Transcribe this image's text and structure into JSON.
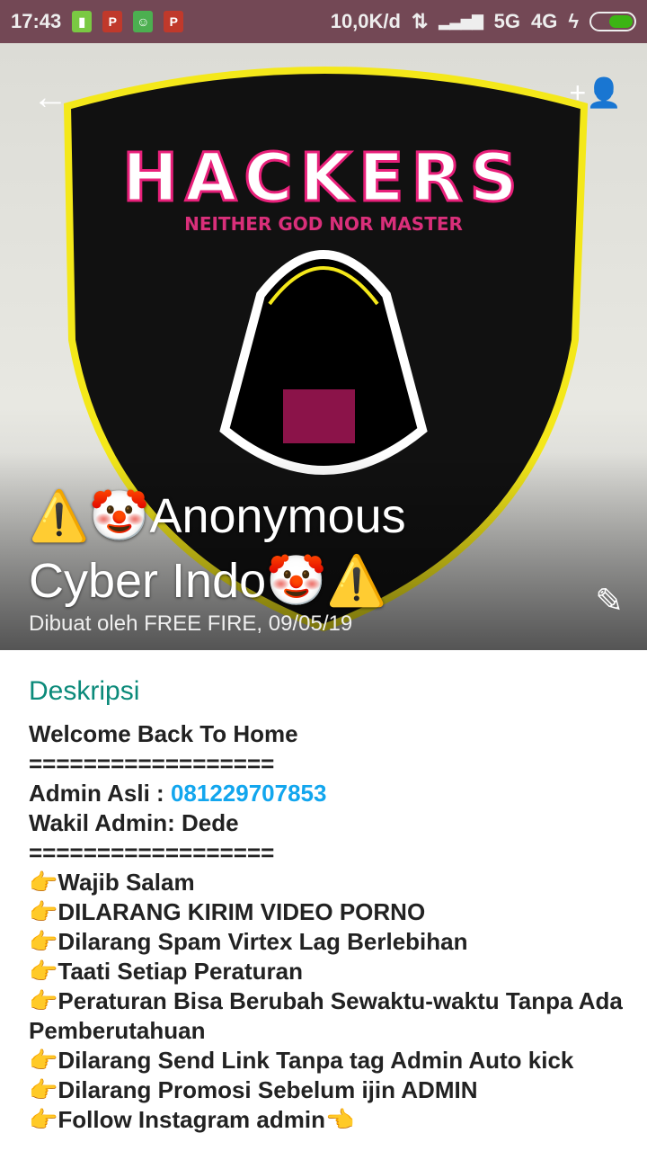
{
  "status_bar": {
    "time": "17:43",
    "speed": "10,0K/d",
    "network1": "5G",
    "network2": "4G",
    "battery_color": "#3cb414"
  },
  "header": {
    "back_icon": "arrow-left-icon",
    "add_participant_icon": "person-add-icon",
    "edit_icon": "pencil-icon",
    "logo_text": "HACKERS",
    "logo_subtext": "NEITHER GOD NOR MASTER",
    "title": "⚠️🤡Anonymous Cyber Indo🤡⚠️",
    "created_by": "Dibuat oleh FREE FIRE, 09/05/19"
  },
  "description": {
    "heading": "Deskripsi",
    "line1": "Welcome Back To Home",
    "sep": "==================",
    "admin_label": "Admin Asli : ",
    "admin_phone": "081229707853",
    "wakil": "Wakil Admin: Dede",
    "rules": [
      "👉Wajib Salam",
      "👉DILARANG KIRIM VIDEO PORNO",
      "👉Dilarang Spam Virtex Lag Berlebihan",
      "👉Taati Setiap Peraturan",
      "👉Peraturan Bisa Berubah Sewaktu-waktu Tanpa Ada Pemberutahuan",
      "👉Dilarang Send Link Tanpa tag Admin Auto kick",
      "👉Dilarang Promosi Sebelum ijin ADMIN",
      "👉Follow Instagram admin👈"
    ]
  }
}
